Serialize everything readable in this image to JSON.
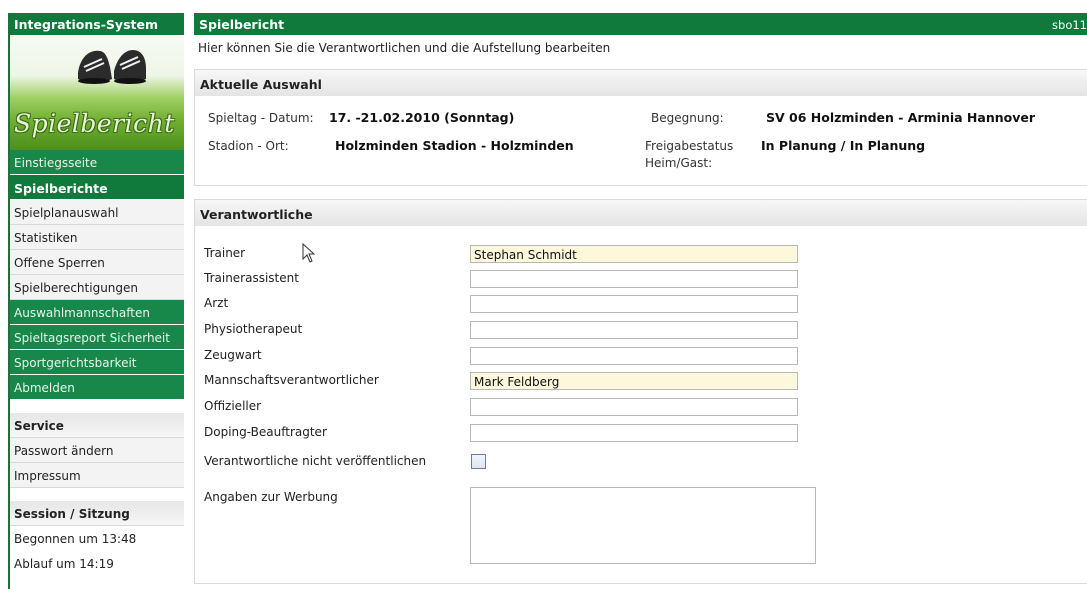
{
  "sidebar": {
    "header": "Integrations-System",
    "banner_title": "Spielbericht",
    "items": [
      {
        "label": "Einstiegsseite",
        "style": "green"
      },
      {
        "label": "Spielberichte",
        "style": "active"
      },
      {
        "label": "Spielplanauswahl",
        "style": "light"
      },
      {
        "label": "Statistiken",
        "style": "light"
      },
      {
        "label": "Offene Sperren",
        "style": "light"
      },
      {
        "label": "Spielberechtigungen",
        "style": "light"
      },
      {
        "label": "Auswahlmannschaften",
        "style": "green"
      },
      {
        "label": "Spieltagsreport Sicherheit",
        "style": "green"
      },
      {
        "label": "Sportgerichtsbarkeit",
        "style": "green"
      },
      {
        "label": "Abmelden",
        "style": "green"
      }
    ],
    "service": {
      "title": "Service",
      "items": [
        "Passwort ändern",
        "Impressum"
      ]
    },
    "session": {
      "title": "Session / Sitzung",
      "started": "Begonnen um 13:48",
      "expires": "Ablauf um 14:19"
    }
  },
  "titlebar": {
    "title": "Spielbericht",
    "code": "sbo11"
  },
  "intro": "Hier können Sie die Verantwortlichen und die Aufstellung bearbeiten",
  "current": {
    "title": "Aktuelle Auswahl",
    "matchday_label": "Spieltag - Datum:",
    "matchday_value": "17. -21.02.2010 (Sonntag)",
    "venue_label": "Stadion - Ort:",
    "venue_value": "Holzminden Stadion - Holzminden",
    "match_label": "Begegnung:",
    "match_value": "SV 06 Holzminden - Arminia Hannover",
    "release_label_1": "Freigabestatus",
    "release_label_2": "Heim/Gast:",
    "release_value": "In Planung / In Planung"
  },
  "responsible": {
    "title": "Verantwortliche",
    "fields": [
      {
        "label": "Trainer",
        "value": "Stephan Schmidt"
      },
      {
        "label": "Trainerassistent",
        "value": ""
      },
      {
        "label": "Arzt",
        "value": ""
      },
      {
        "label": "Physiotherapeut",
        "value": ""
      },
      {
        "label": "Zeugwart",
        "value": ""
      },
      {
        "label": "Mannschaftsverantwortlicher",
        "value": "Mark Feldberg"
      },
      {
        "label": "Offizieller",
        "value": ""
      },
      {
        "label": "Doping-Beauftragter",
        "value": ""
      }
    ],
    "no_publish_label": "Verantwortliche nicht veröffentlichen",
    "no_publish_checked": false,
    "advertising_label": "Angaben zur Werbung",
    "advertising_value": ""
  },
  "colors": {
    "brand_green": "#0f7a3c",
    "menu_green": "#17874a",
    "field_highlight": "#fdf8dc"
  }
}
